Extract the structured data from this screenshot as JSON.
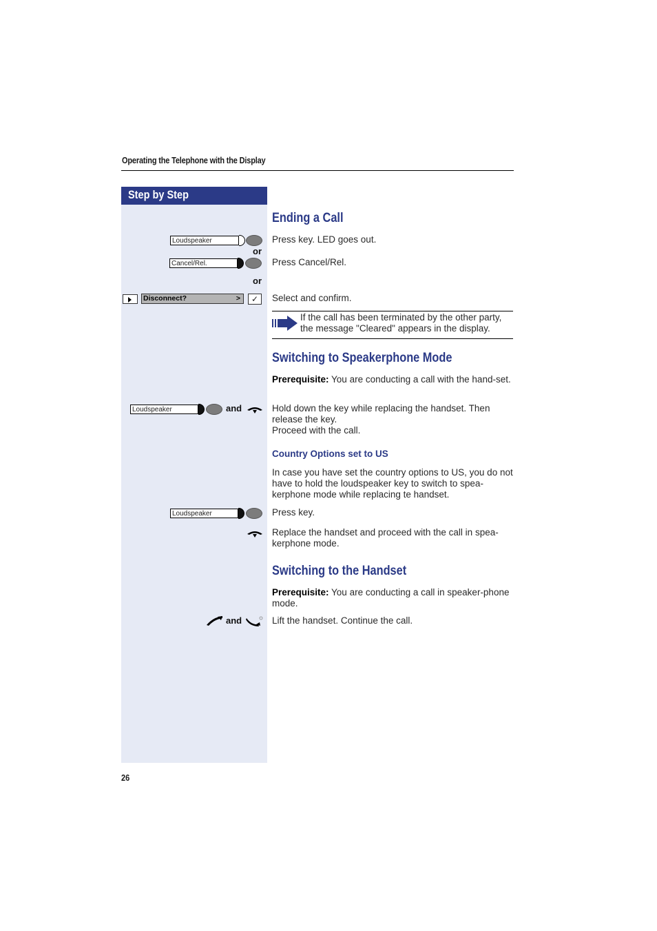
{
  "running_head": "Operating the Telephone with the Display",
  "step_by_step_label": "Step by Step",
  "page_number": "26",
  "colors": {
    "accent": "#2b3a87",
    "column_bg": "#e6eaf5"
  },
  "sections": {
    "ending": {
      "title": "Ending a Call",
      "step1": {
        "key_label": "Loudspeaker",
        "text": "Press key. LED goes out."
      },
      "or1": "or",
      "step2": {
        "key_label": "Cancel/Rel.",
        "text": "Press Cancel/Rel."
      },
      "or2": "or",
      "step3": {
        "display_text": "Disconnect?",
        "display_arrow": ">",
        "confirm_icon": "✓",
        "text": "Select and confirm."
      },
      "note": "If the call has been terminated by the other party, the message \"Cleared\"  appears in the display."
    },
    "speakerphone": {
      "title": "Switching to Speakerphone Mode",
      "prereq_label": "Prerequisite:",
      "prereq_text": " You are conducting a call with the hand-set.",
      "step1": {
        "key_label": "Loudspeaker",
        "and": "and",
        "text_l1": "Hold down the key while replacing the handset. Then release the key.",
        "text_l2": "Proceed with the call."
      },
      "subtitle": "Country Options set to US",
      "us_text": "In case you have set the country options to US, you do not have to hold the loudspeaker key to switch to spea-kerphone mode while replacing te handset.",
      "step2": {
        "key_label": "Loudspeaker",
        "text": "Press key."
      },
      "step3": {
        "text": "Replace the handset and proceed with the call in spea-kerphone mode."
      }
    },
    "handset": {
      "title": "Switching to the Handset",
      "prereq_label": "Prerequisite:",
      "prereq_text": " You are conducting a call in speaker-phone mode.",
      "step1": {
        "and": "and",
        "text": "Lift the handset. Continue the call."
      }
    }
  },
  "icons": {
    "note_arrow": "arrow-right-icon",
    "handset_down": "handset-on-hook-icon",
    "handset_up": "handset-off-hook-icon"
  }
}
